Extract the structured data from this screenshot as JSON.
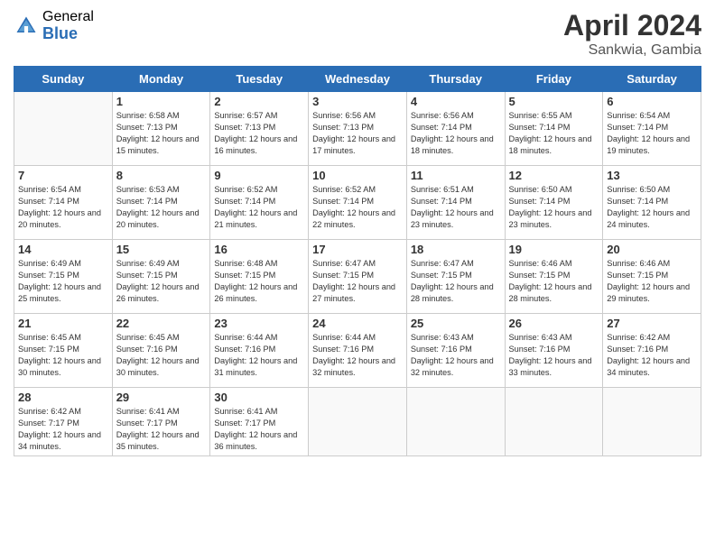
{
  "header": {
    "logo_general": "General",
    "logo_blue": "Blue",
    "title": "April 2024",
    "subtitle": "Sankwia, Gambia"
  },
  "days": [
    "Sunday",
    "Monday",
    "Tuesday",
    "Wednesday",
    "Thursday",
    "Friday",
    "Saturday"
  ],
  "weeks": [
    [
      {
        "date": "",
        "sunrise": "",
        "sunset": "",
        "daylight": ""
      },
      {
        "date": "1",
        "sunrise": "6:58 AM",
        "sunset": "7:13 PM",
        "daylight": "12 hours and 15 minutes."
      },
      {
        "date": "2",
        "sunrise": "6:57 AM",
        "sunset": "7:13 PM",
        "daylight": "12 hours and 16 minutes."
      },
      {
        "date": "3",
        "sunrise": "6:56 AM",
        "sunset": "7:13 PM",
        "daylight": "12 hours and 17 minutes."
      },
      {
        "date": "4",
        "sunrise": "6:56 AM",
        "sunset": "7:14 PM",
        "daylight": "12 hours and 18 minutes."
      },
      {
        "date": "5",
        "sunrise": "6:55 AM",
        "sunset": "7:14 PM",
        "daylight": "12 hours and 18 minutes."
      },
      {
        "date": "6",
        "sunrise": "6:54 AM",
        "sunset": "7:14 PM",
        "daylight": "12 hours and 19 minutes."
      }
    ],
    [
      {
        "date": "7",
        "sunrise": "6:54 AM",
        "sunset": "7:14 PM",
        "daylight": "12 hours and 20 minutes."
      },
      {
        "date": "8",
        "sunrise": "6:53 AM",
        "sunset": "7:14 PM",
        "daylight": "12 hours and 20 minutes."
      },
      {
        "date": "9",
        "sunrise": "6:52 AM",
        "sunset": "7:14 PM",
        "daylight": "12 hours and 21 minutes."
      },
      {
        "date": "10",
        "sunrise": "6:52 AM",
        "sunset": "7:14 PM",
        "daylight": "12 hours and 22 minutes."
      },
      {
        "date": "11",
        "sunrise": "6:51 AM",
        "sunset": "7:14 PM",
        "daylight": "12 hours and 23 minutes."
      },
      {
        "date": "12",
        "sunrise": "6:50 AM",
        "sunset": "7:14 PM",
        "daylight": "12 hours and 23 minutes."
      },
      {
        "date": "13",
        "sunrise": "6:50 AM",
        "sunset": "7:14 PM",
        "daylight": "12 hours and 24 minutes."
      }
    ],
    [
      {
        "date": "14",
        "sunrise": "6:49 AM",
        "sunset": "7:15 PM",
        "daylight": "12 hours and 25 minutes."
      },
      {
        "date": "15",
        "sunrise": "6:49 AM",
        "sunset": "7:15 PM",
        "daylight": "12 hours and 26 minutes."
      },
      {
        "date": "16",
        "sunrise": "6:48 AM",
        "sunset": "7:15 PM",
        "daylight": "12 hours and 26 minutes."
      },
      {
        "date": "17",
        "sunrise": "6:47 AM",
        "sunset": "7:15 PM",
        "daylight": "12 hours and 27 minutes."
      },
      {
        "date": "18",
        "sunrise": "6:47 AM",
        "sunset": "7:15 PM",
        "daylight": "12 hours and 28 minutes."
      },
      {
        "date": "19",
        "sunrise": "6:46 AM",
        "sunset": "7:15 PM",
        "daylight": "12 hours and 28 minutes."
      },
      {
        "date": "20",
        "sunrise": "6:46 AM",
        "sunset": "7:15 PM",
        "daylight": "12 hours and 29 minutes."
      }
    ],
    [
      {
        "date": "21",
        "sunrise": "6:45 AM",
        "sunset": "7:15 PM",
        "daylight": "12 hours and 30 minutes."
      },
      {
        "date": "22",
        "sunrise": "6:45 AM",
        "sunset": "7:16 PM",
        "daylight": "12 hours and 30 minutes."
      },
      {
        "date": "23",
        "sunrise": "6:44 AM",
        "sunset": "7:16 PM",
        "daylight": "12 hours and 31 minutes."
      },
      {
        "date": "24",
        "sunrise": "6:44 AM",
        "sunset": "7:16 PM",
        "daylight": "12 hours and 32 minutes."
      },
      {
        "date": "25",
        "sunrise": "6:43 AM",
        "sunset": "7:16 PM",
        "daylight": "12 hours and 32 minutes."
      },
      {
        "date": "26",
        "sunrise": "6:43 AM",
        "sunset": "7:16 PM",
        "daylight": "12 hours and 33 minutes."
      },
      {
        "date": "27",
        "sunrise": "6:42 AM",
        "sunset": "7:16 PM",
        "daylight": "12 hours and 34 minutes."
      }
    ],
    [
      {
        "date": "28",
        "sunrise": "6:42 AM",
        "sunset": "7:17 PM",
        "daylight": "12 hours and 34 minutes."
      },
      {
        "date": "29",
        "sunrise": "6:41 AM",
        "sunset": "7:17 PM",
        "daylight": "12 hours and 35 minutes."
      },
      {
        "date": "30",
        "sunrise": "6:41 AM",
        "sunset": "7:17 PM",
        "daylight": "12 hours and 36 minutes."
      },
      {
        "date": "",
        "sunrise": "",
        "sunset": "",
        "daylight": ""
      },
      {
        "date": "",
        "sunrise": "",
        "sunset": "",
        "daylight": ""
      },
      {
        "date": "",
        "sunrise": "",
        "sunset": "",
        "daylight": ""
      },
      {
        "date": "",
        "sunrise": "",
        "sunset": "",
        "daylight": ""
      }
    ]
  ],
  "labels": {
    "sunrise": "Sunrise:",
    "sunset": "Sunset:",
    "daylight": "Daylight:"
  }
}
